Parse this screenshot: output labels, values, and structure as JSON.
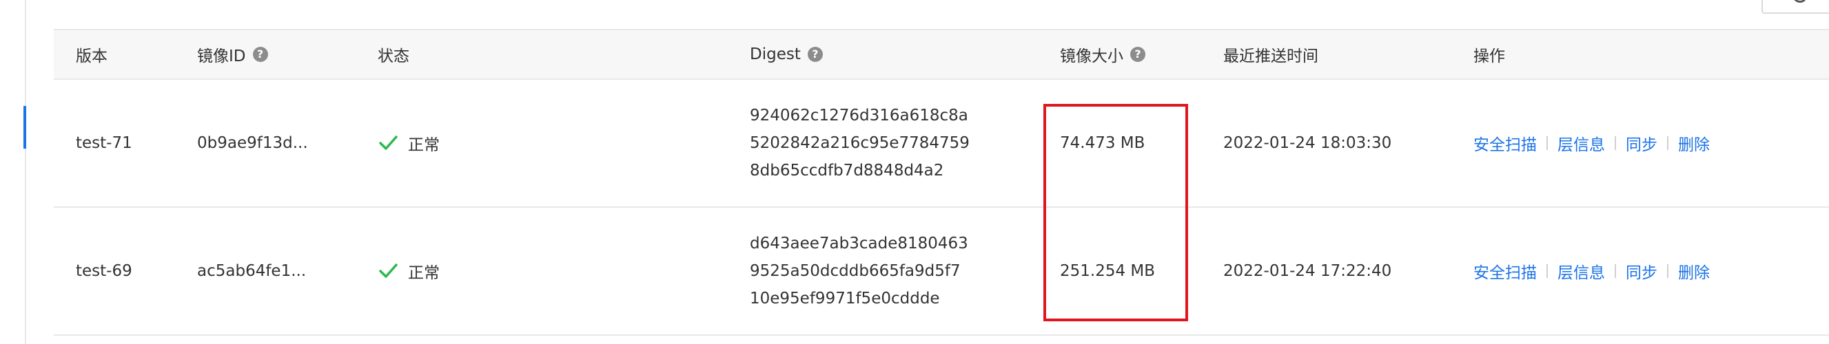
{
  "table": {
    "headers": {
      "version": "版本",
      "image_id": "镜像ID",
      "status": "状态",
      "digest": "Digest",
      "size": "镜像大小",
      "push_time": "最近推送时间",
      "actions": "操作"
    },
    "rows": [
      {
        "version": "test-71",
        "image_id": "0b9ae9f13d...",
        "status": "正常",
        "digest": [
          "924062c1276d316a618c8a",
          "5202842a216c95e7784759",
          "8db65ccdfb7d8848d4a2"
        ],
        "size": "74.473 MB",
        "push_time": "2022-01-24 18:03:30",
        "actions": [
          "安全扫描",
          "层信息",
          "同步",
          "删除"
        ]
      },
      {
        "version": "test-69",
        "image_id": "ac5ab64fe1...",
        "status": "正常",
        "digest": [
          "d643aee7ab3cade8180463",
          "9525a50dcddb665fa9d5f7",
          "10e95ef9971f5e0cddde"
        ],
        "size": "251.254 MB",
        "push_time": "2022-01-24 17:22:40",
        "actions": [
          "安全扫描",
          "层信息",
          "同步",
          "删除"
        ]
      }
    ]
  },
  "icons": {
    "help": "help-icon",
    "status_ok": "check-icon",
    "refresh": "refresh-icon"
  },
  "colors": {
    "link": "#1a73e8",
    "status_ok": "#2db84d",
    "highlight": "#e0161f",
    "header_bg": "#f7f7f7"
  }
}
